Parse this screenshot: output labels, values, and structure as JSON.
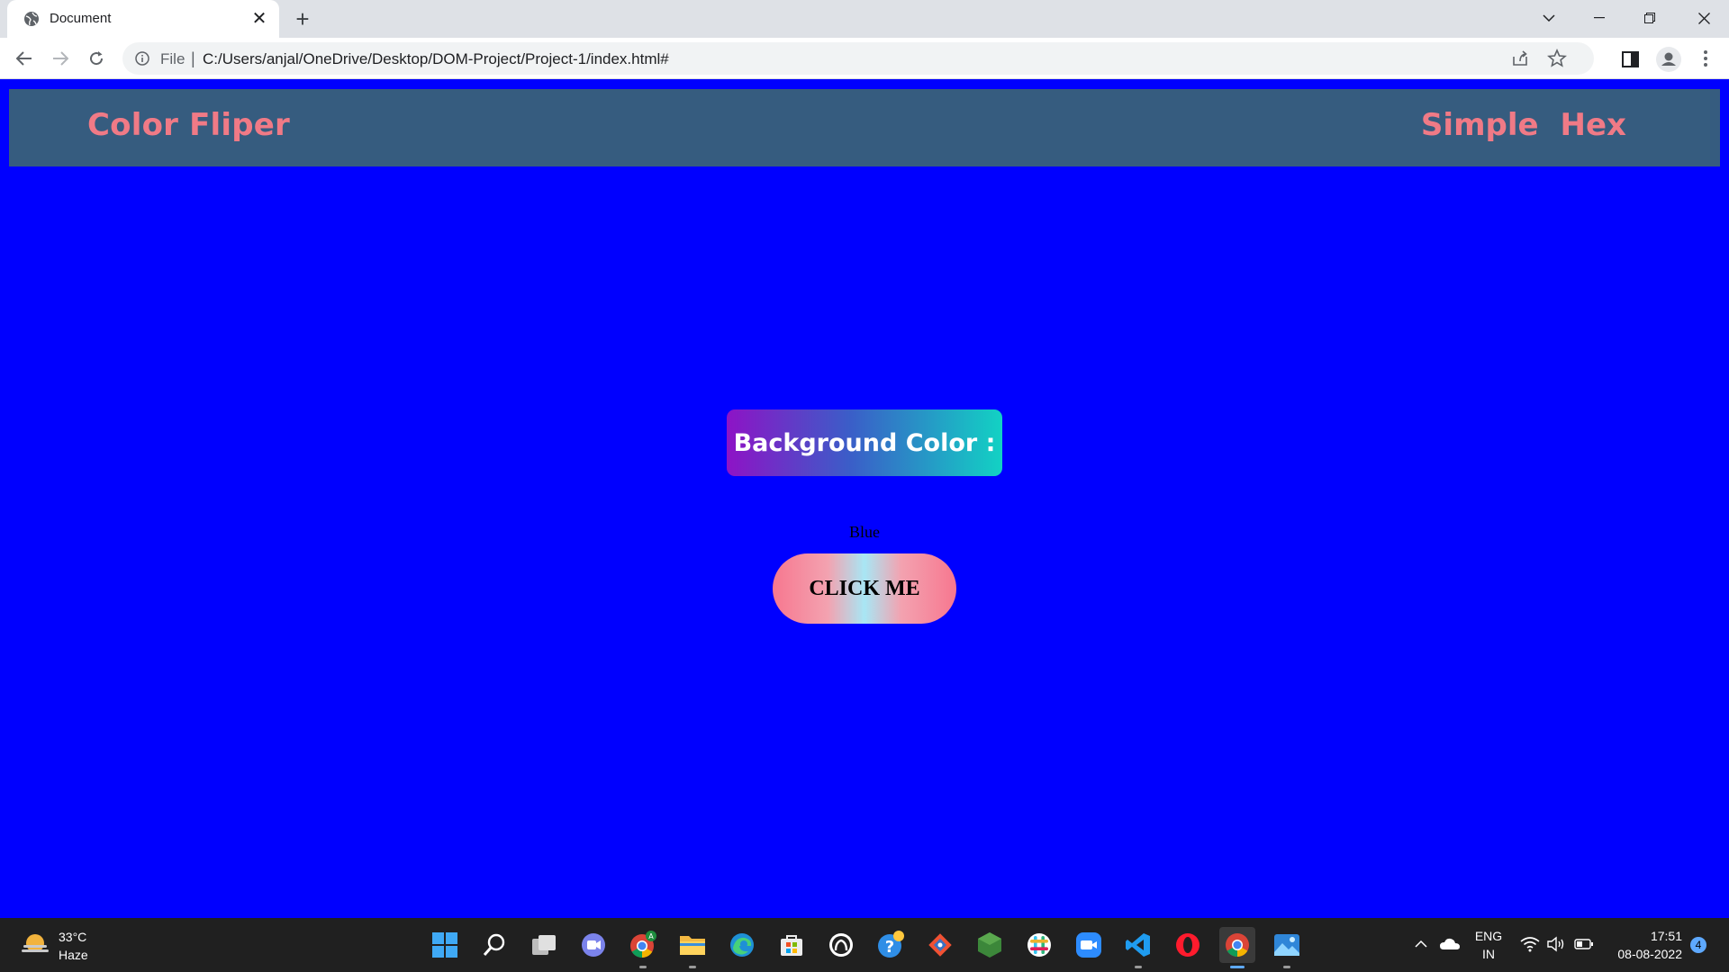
{
  "browser": {
    "tab_title": "Document",
    "tab_close": "✕",
    "new_tab": "+",
    "scheme_label": "File",
    "separator": "|",
    "url": "C:/Users/anjal/OneDrive/Desktop/DOM-Project/Project-1/index.html#"
  },
  "page": {
    "background_color": "#0000ff",
    "header": {
      "title": "Color Fliper",
      "nav_links": [
        "Simple",
        "Hex"
      ]
    },
    "bg_label": "Background Color :",
    "color_name": "Blue",
    "button_label": "CLICK ME"
  },
  "taskbar": {
    "weather_temp": "33°C",
    "weather_desc": "Haze",
    "apps": [
      "start-icon",
      "search-icon",
      "task-view-icon",
      "teams-chat-icon",
      "chrome-profile-icon",
      "file-explorer-icon",
      "edge-icon",
      "microsoft-store-icon",
      "github-desktop-icon",
      "get-help-icon",
      "git-icon",
      "nodejs-icon",
      "slack-icon",
      "zoom-icon",
      "vscode-icon",
      "opera-icon",
      "chrome-icon",
      "photos-icon"
    ],
    "lang_line1": "ENG",
    "lang_line2": "IN",
    "time": "17:51",
    "date": "08-08-2022",
    "notifications": "4"
  }
}
